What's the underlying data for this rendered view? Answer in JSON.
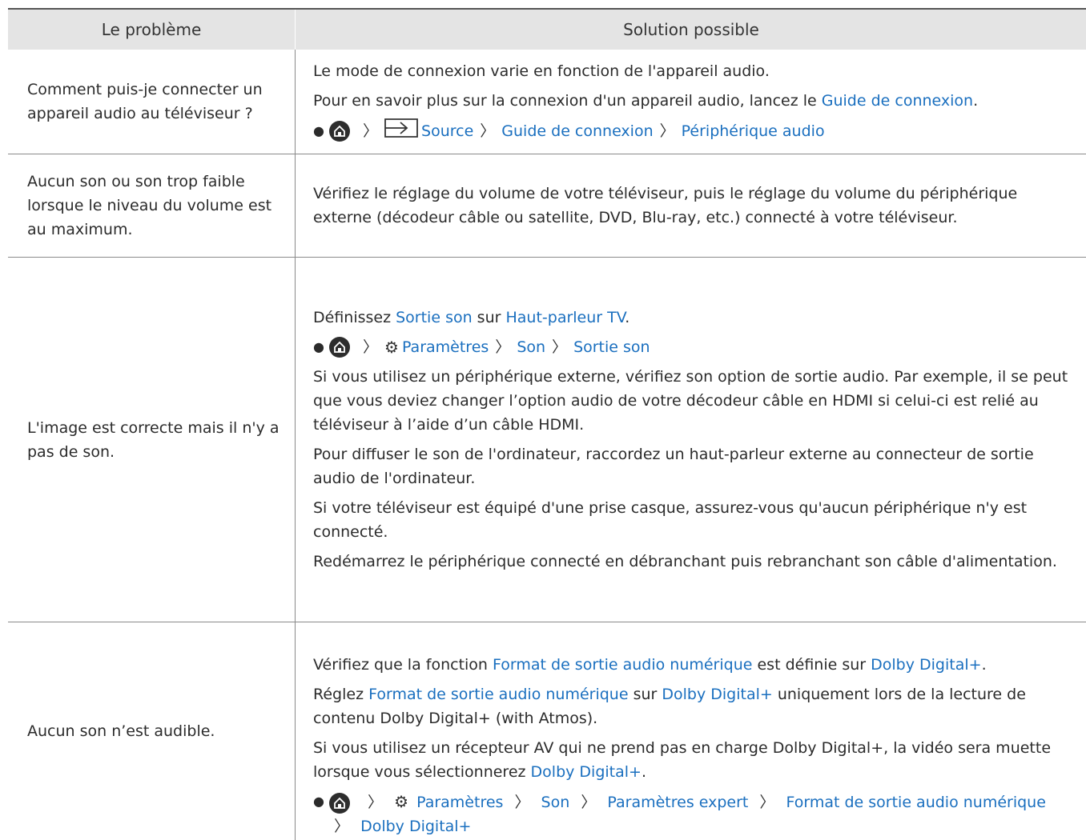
{
  "header": {
    "col1": "Le problème",
    "col2": "Solution possible"
  },
  "rows": [
    {
      "problem": "Comment puis-je connecter un appareil audio au téléviseur ?",
      "p1": "Le mode de connexion varie en fonction de l'appareil audio.",
      "p2_a": "Pour en savoir plus sur la connexion d'un appareil audio, lancez le ",
      "p2_link": "Guide de connexion",
      "p2_b": ".",
      "path": [
        "Source",
        "Guide de connexion",
        "Périphérique audio"
      ]
    },
    {
      "problem": "Aucun son ou son trop faible lorsque le niveau du volume est au maximum.",
      "p1": "Vérifiez le réglage du volume de votre téléviseur, puis le réglage du volume du périphérique externe (décodeur câble ou satellite, DVD, Blu-ray, etc.) connecté à votre téléviseur."
    },
    {
      "problem": "L'image est correcte mais il n'y a pas de son.",
      "p1_a": "Définissez ",
      "p1_link1": "Sortie son",
      "p1_b": " sur ",
      "p1_link2": "Haut-parleur TV",
      "p1_c": ".",
      "path": [
        "Paramètres",
        "Son",
        "Sortie son"
      ],
      "p2": "Si vous utilisez un périphérique externe, vérifiez son option de sortie audio. Par exemple, il se peut que vous deviez changer l’option audio de votre décodeur câble en HDMI si celui-ci est relié au téléviseur à l’aide d’un câble HDMI.",
      "p3": "Pour diffuser le son de l'ordinateur, raccordez un haut-parleur externe au connecteur de sortie audio de l'ordinateur.",
      "p4": "Si votre téléviseur est équipé d'une prise casque, assurez-vous qu'aucun périphérique n'y est connecté.",
      "p5": "Redémarrez le périphérique connecté en débranchant puis rebranchant son câble d'alimentation."
    },
    {
      "problem": "Aucun son n’est audible.",
      "p1_a": "Vérifiez que la fonction ",
      "p1_link1": "Format de sortie audio numérique",
      "p1_b": " est définie sur ",
      "p1_link2": "Dolby Digital+",
      "p1_c": ".",
      "p2_a": "Réglez ",
      "p2_link1": "Format de sortie audio numérique",
      "p2_b": " sur ",
      "p2_link2": "Dolby Digital+",
      "p2_c": " uniquement lors de la lecture de contenu Dolby Digital+ (with Atmos).",
      "p3_a": "Si vous utilisez un récepteur AV qui ne prend pas en charge Dolby Digital+, la vidéo sera muette lorsque vous sélectionnerez ",
      "p3_link": "Dolby Digital+",
      "p3_b": ".",
      "path": [
        "Paramètres",
        "Son",
        "Paramètres expert",
        "Format de sortie audio numérique",
        "Dolby Digital+"
      ]
    }
  ],
  "icons": {
    "home": "home-icon",
    "source": "source-icon",
    "settings": "gear-icon",
    "chevron": "chevron-right-icon"
  },
  "colors": {
    "link": "#1a6fbf",
    "header_bg": "#e4e4e4"
  }
}
